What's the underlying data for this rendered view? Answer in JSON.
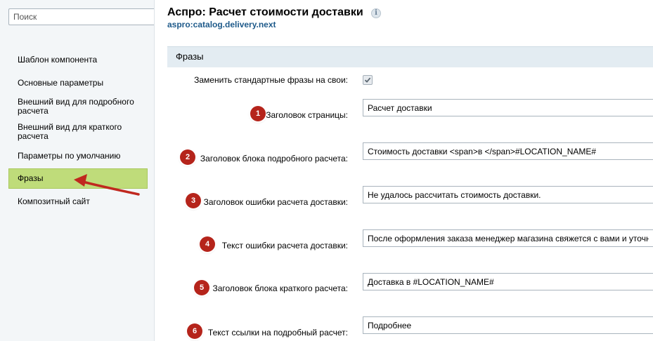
{
  "sidebar": {
    "search_placeholder": "Поиск",
    "items": [
      {
        "label": "Шаблон компонента"
      },
      {
        "label": "Основные параметры"
      },
      {
        "label": "Внешний вид для подробного расчета"
      },
      {
        "label": "Внешний вид для краткого расчета"
      },
      {
        "label": "Параметры по умолчанию"
      },
      {
        "label": "Фразы",
        "active": true
      },
      {
        "label": "Композитный сайт"
      }
    ]
  },
  "header": {
    "title": "Аспро: Расчет стоимости доставки",
    "subtitle": "aspro:catalog.delivery.next",
    "info_icon": "i"
  },
  "section": {
    "title": "Фразы",
    "checkbox": {
      "label": "Заменить стандартные фразы на свои:",
      "checked": true
    },
    "fields": [
      {
        "badge": "1",
        "label": "Заголовок страницы:",
        "value": "Расчет доставки"
      },
      {
        "badge": "2",
        "label": "Заголовок блока подробного расчета:",
        "value": "Стоимость доставки <span>в </span>#LOCATION_NAME#"
      },
      {
        "badge": "3",
        "label": "Заголовок ошибки расчета доставки:",
        "value": "Не удалось рассчитать стоимость доставки."
      },
      {
        "badge": "4",
        "label": "Текст ошибки расчета доставки:",
        "value": "После оформления заказа менеджер магазина свяжется с вами и уточнит"
      },
      {
        "badge": "5",
        "label": "Заголовок блока краткого расчета:",
        "value": "Доставка в #LOCATION_NAME#"
      },
      {
        "badge": "6",
        "label": "Текст ссылки на подробный расчет:",
        "value": "Подробнее"
      }
    ]
  },
  "colors": {
    "accent_active": "#bfdc7a",
    "badge": "#b5241b",
    "arrow": "#c0281f",
    "subtitle": "#1e5a8a"
  }
}
